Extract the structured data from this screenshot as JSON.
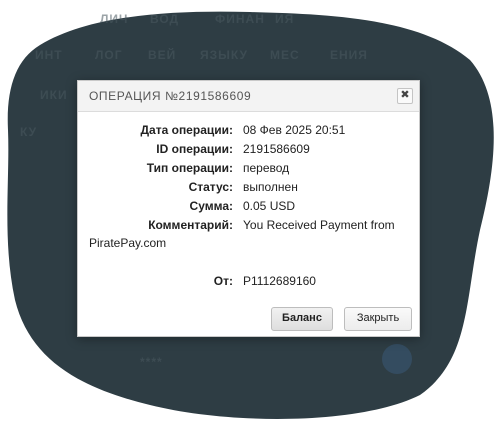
{
  "background": {
    "blob_color": "#2e3d44",
    "ghost_text": [
      "ЛИЧ",
      "ВОД",
      "ФИНАН",
      "ИЯ",
      "ИНТ",
      "ЛОГ",
      "ВЕЙ",
      "ЯЗЫКУ",
      "МЕС",
      "ЕНИЯ",
      "ИКИ",
      "КУ",
      "****"
    ]
  },
  "dialog": {
    "title": "ОПЕРАЦИЯ №2191586609",
    "close_symbol": "✖",
    "fields": [
      {
        "label": "Дата операции:",
        "value": "08 Фев 2025 20:51"
      },
      {
        "label": "ID операции:",
        "value": "2191586609"
      },
      {
        "label": "Тип операции:",
        "value": "перевод"
      },
      {
        "label": "Статус:",
        "value": "выполнен"
      },
      {
        "label": "Сумма:",
        "value": "0.05 USD"
      },
      {
        "label": "Комментарий:",
        "value": "You Received Payment from"
      }
    ],
    "comment_continuation": "PiratePay.com",
    "from": {
      "label": "От:",
      "value": "P1112689160"
    },
    "buttons": {
      "balance": "Баланс",
      "close": "Закрыть"
    }
  }
}
